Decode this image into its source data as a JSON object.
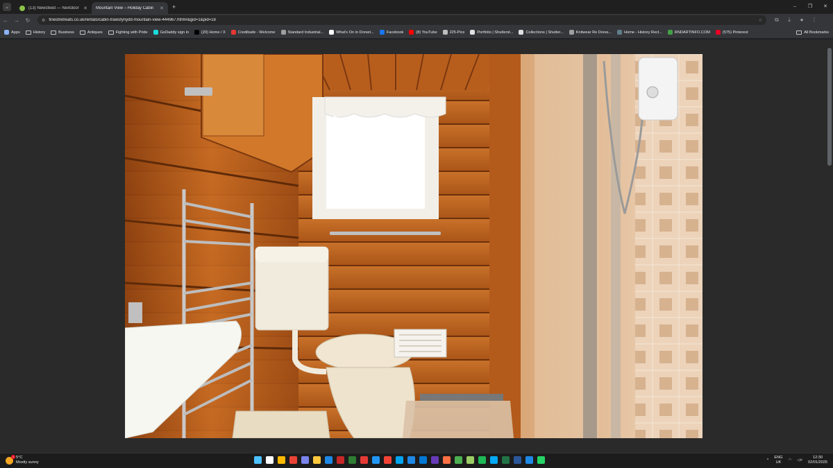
{
  "tabs": [
    {
      "title": "(13) Newsfeed — Nextdoor",
      "color": "#8bc34a",
      "active": false
    },
    {
      "title": "Mountain View – Holiday Cabin",
      "color": "#35363a",
      "active": true
    }
  ],
  "toolbar": {
    "url": "finestretreats.co.uk/rentals/cabin-trawsfynydd-mountain-view-444967.html#&gid=1&pid=18"
  },
  "bookmarks": [
    {
      "label": "Apps",
      "type": "apps"
    },
    {
      "label": "History",
      "type": "folder"
    },
    {
      "label": "Business",
      "type": "folder"
    },
    {
      "label": "Antiques",
      "type": "folder"
    },
    {
      "label": "Fighting with Pride",
      "type": "folder"
    },
    {
      "label": "GoDaddy sign in",
      "type": "site",
      "color": "#1bdbdb"
    },
    {
      "label": "(20) Home / X",
      "type": "site",
      "color": "#000000"
    },
    {
      "label": "Creditsafe - Welcome",
      "type": "site",
      "color": "#e53935"
    },
    {
      "label": "Standard Industrial...",
      "type": "site",
      "color": "#9e9e9e"
    },
    {
      "label": "What's On in Dorset...",
      "type": "site",
      "color": "#ffffff"
    },
    {
      "label": "Facebook",
      "type": "site",
      "color": "#1877f2"
    },
    {
      "label": "(8) YouTube",
      "type": "site",
      "color": "#ff0000"
    },
    {
      "label": "225-Pics",
      "type": "site",
      "color": "#bdbdbd"
    },
    {
      "label": "Portfolio | Shutterst...",
      "type": "site",
      "color": "#e0e0e0"
    },
    {
      "label": "Collections | Shutter...",
      "type": "site",
      "color": "#e0e0e0"
    },
    {
      "label": "Knitwear Re Dress...",
      "type": "site",
      "color": "#9e9e9e"
    },
    {
      "label": "Home - History Recl...",
      "type": "site",
      "color": "#607d8b"
    },
    {
      "label": "RNDARTINFO.COM",
      "type": "site",
      "color": "#43a047"
    },
    {
      "label": "(575) Pinterest",
      "type": "site",
      "color": "#e60023"
    }
  ],
  "bookmarks_all": "All Bookmarks",
  "weather": {
    "temp": "5°C",
    "desc": "Mostly sunny",
    "badge": "1"
  },
  "tray": {
    "lang1": "ENG",
    "lang2": "UK",
    "time": "12:30",
    "date": "02/01/2025"
  },
  "taskbar_icons": [
    "#4cc2ff",
    "#ffffff",
    "#ffb900",
    "#ea4335",
    "#7b83eb",
    "#ffc83d",
    "#1e88e5",
    "#c62828",
    "#2e7d32",
    "#e53935",
    "#2196f3",
    "#f44336",
    "#00a4ef",
    "#1e88e5",
    "#0078d4",
    "#673ab7",
    "#ff7043",
    "#4caf50",
    "#9ccc65",
    "#1db954",
    "#03a9f4",
    "#217346",
    "#2b579a",
    "#1e88e5",
    "#25d366"
  ]
}
